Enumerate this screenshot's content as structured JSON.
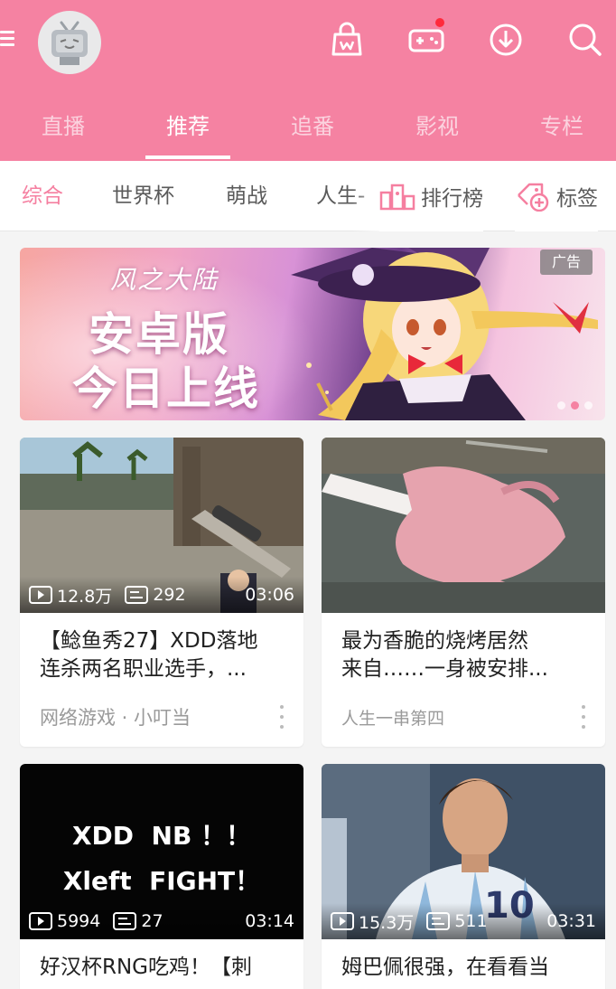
{
  "header": {
    "tabs": [
      {
        "label": "直播",
        "active": false
      },
      {
        "label": "推荐",
        "active": true
      },
      {
        "label": "追番",
        "active": false
      },
      {
        "label": "影视",
        "active": false
      },
      {
        "label": "专栏",
        "active": false
      }
    ],
    "icons": [
      "menu-icon",
      "avatar-tv-icon",
      "shopping-bag-icon",
      "game-controller-icon",
      "download-icon",
      "search-icon"
    ],
    "accent": "#f582a2",
    "notification_color": "#ff2a3c"
  },
  "subnav": {
    "chips": [
      {
        "label": "综合",
        "active": true
      },
      {
        "label": "世界杯",
        "active": false
      },
      {
        "label": "萌战",
        "active": false
      },
      {
        "label": "人生-",
        "active": false
      }
    ],
    "rank_label": "排行榜",
    "tag_label": "标签"
  },
  "banner": {
    "logo_text": "风之大陆",
    "line1": "安卓版",
    "line2": "今日上线",
    "ad_label": "广告"
  },
  "cards": [
    {
      "views": "12.8万",
      "danmaku": "292",
      "duration": "03:06",
      "title_line1": "【鲶鱼秀27】XDD落地",
      "title_line2": "连杀两名职业选手，...",
      "meta": "网络游戏 · 小叮当"
    },
    {
      "views": "",
      "danmaku": "",
      "duration": "",
      "title_line1": "最为香脆的烧烤居然",
      "title_line2": "来自……一身被安排...",
      "meta": "人生一串第四"
    },
    {
      "views": "5994",
      "danmaku": "27",
      "duration": "03:14",
      "thumb_text_line1": "XDD  NB ！！",
      "thumb_text_line2": "Xleft  FIGHT！",
      "title_line1": "好汉杯RNG吃鸡！【刺"
    },
    {
      "views": "15.3万",
      "danmaku": "511",
      "duration": "03:31",
      "title_line1": "姆巴佩很强，在看看当"
    }
  ]
}
